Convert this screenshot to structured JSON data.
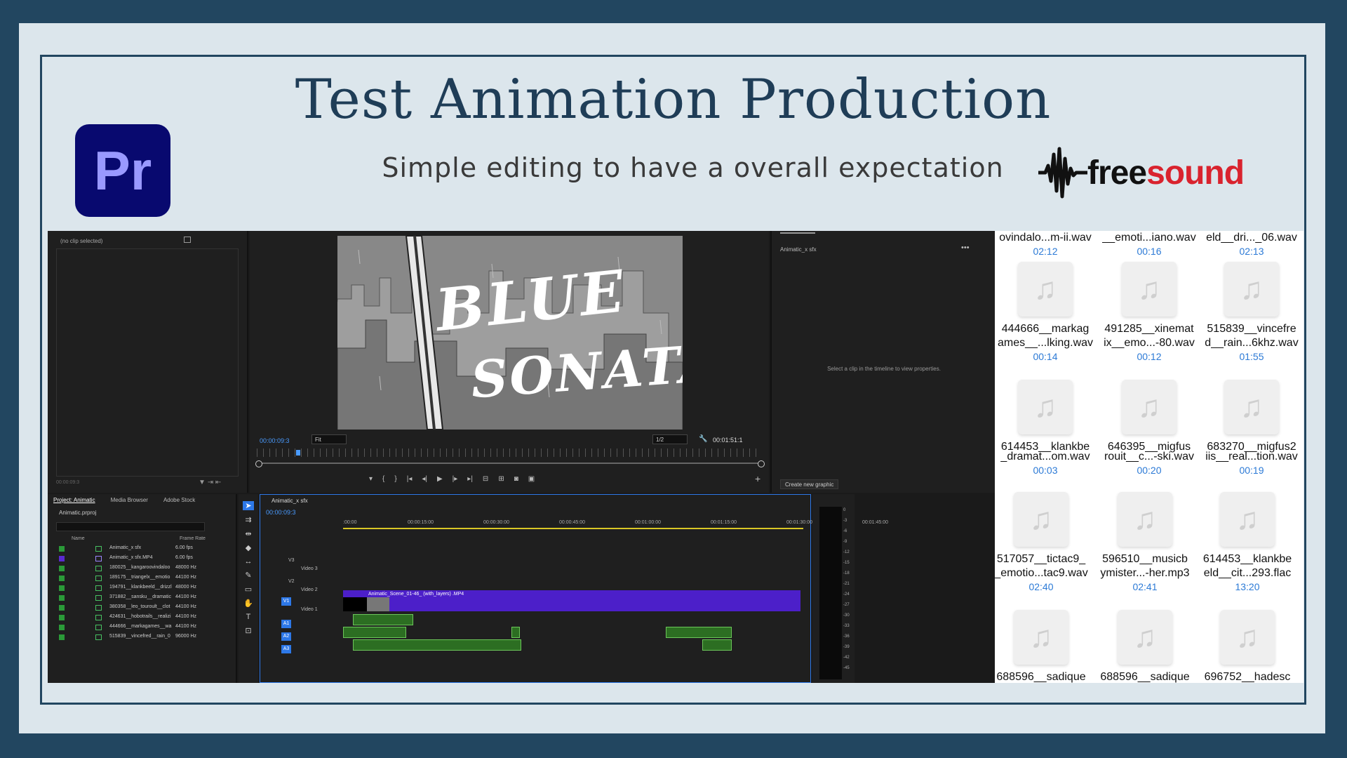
{
  "header": {
    "title": "Test Animation Production",
    "subtitle": "Simple editing to have a overall expectation",
    "left_logo_text": "Pr",
    "right_logo_text_a": "free",
    "right_logo_text_b": "sound"
  },
  "premiere": {
    "source_label": "(no clip selected)",
    "source_timecode": "00:00:09:3",
    "video_text_line1": "BLUE",
    "video_text_line2": "SONATA",
    "program_timecode": "00:00:09:3",
    "fit_label": "Fit",
    "resolution_label": "1/2",
    "duration": "00:01:51:1",
    "graphics_title": "Animatic_x sfx",
    "graphics_message": "Select a clip in the timeline to view properties.",
    "create_graphic_label": "Create new graphic",
    "project_tabs": [
      "Project: Animatic",
      "Media Browser",
      "Adobe Stock"
    ],
    "project_file": "Animatic.prproj",
    "col_name": "Name",
    "col_frame_rate": "Frame Rate",
    "project_rows": [
      {
        "name": "Animatic_x sfx",
        "rate": "6.00 fps"
      },
      {
        "name": "Animatic_x sfx.MP4",
        "rate": "6.00 fps"
      },
      {
        "name": "180025__kangaroovindaloo",
        "rate": "48000 Hz"
      },
      {
        "name": "189175__triangelx__emotio",
        "rate": "44100 Hz"
      },
      {
        "name": "194791__klankbeeld__drizzl",
        "rate": "48000 Hz"
      },
      {
        "name": "371882__sansku__dramatic",
        "rate": "44100 Hz"
      },
      {
        "name": "380358__leo_touroult__clot",
        "rate": "44100 Hz"
      },
      {
        "name": "424631__hobotrails__realizi",
        "rate": "44100 Hz"
      },
      {
        "name": "444666__markagames__wa",
        "rate": "44100 Hz"
      },
      {
        "name": "515839__vincefred__rain_0",
        "rate": "96000 Hz"
      }
    ],
    "timeline_tab": "Animatic_x sfx",
    "timeline_timecode": "00:00:09:3",
    "ruler_marks": [
      ":00:00",
      "00:00:15:00",
      "00:00:30:00",
      "00:00:45:00",
      "00:01:00:00",
      "00:01:15:00",
      "00:01:30:00",
      "00:01:45:00"
    ],
    "tracks": {
      "v3": "V3",
      "v3_name": "Video 3",
      "v2": "V2",
      "v2_name": "Video 2",
      "v1": "V1",
      "v1_name": "Video 1",
      "a1": "A1",
      "a2": "A2",
      "a3": "A3"
    },
    "v1_clip": "Animatic_Scene_01-46_ (with_layers) .MP4",
    "meter_scale": [
      "0",
      "-3",
      "-6",
      "-9",
      "-12",
      "-15",
      "-18",
      "-21",
      "-24",
      "-27",
      "-30",
      "-33",
      "-36",
      "-39",
      "-42",
      "-45"
    ]
  },
  "freesound": {
    "top_row": [
      {
        "name": "ovindalo...m-ii.wav",
        "time": "02:12"
      },
      {
        "name": "__emoti...iano.wav",
        "time": "00:16"
      },
      {
        "name": "eld__dri..._06.wav",
        "time": "02:13"
      }
    ],
    "files": [
      {
        "name1": "444666__markag",
        "name2": "ames__...lking.wav",
        "time": "00:14"
      },
      {
        "name1": "491285__xinemat",
        "name2": "ix__emo...-80.wav",
        "time": "00:12"
      },
      {
        "name1": "515839__vincefre",
        "name2": "d__rain...6khz.wav",
        "time": "01:55"
      },
      {
        "name1": "614453__klankbe",
        "name2": "_dramat...om.wav",
        "time": "00:03"
      },
      {
        "name1": "646395__migfus",
        "name2": "rouit__c...-ski.wav",
        "time": "00:20"
      },
      {
        "name1": "683270__migfus2",
        "name2": "iis__real...tion.wav",
        "time": "00:19"
      },
      {
        "name1": "517057__tictac9_",
        "name2": "_emotio...tac9.wav",
        "time": "02:40"
      },
      {
        "name1": "596510__musicb",
        "name2": "ymister...-her.mp3",
        "time": "02:41"
      },
      {
        "name1": "614453__klankbe",
        "name2": "eld__cit...293.flac",
        "time": "13:20"
      },
      {
        "name1": "688596__sadique",
        "name2": "",
        "time": ""
      },
      {
        "name1": "688596__sadique",
        "name2": "",
        "time": ""
      },
      {
        "name1": "696752__hadesc",
        "name2": "",
        "time": ""
      }
    ]
  }
}
